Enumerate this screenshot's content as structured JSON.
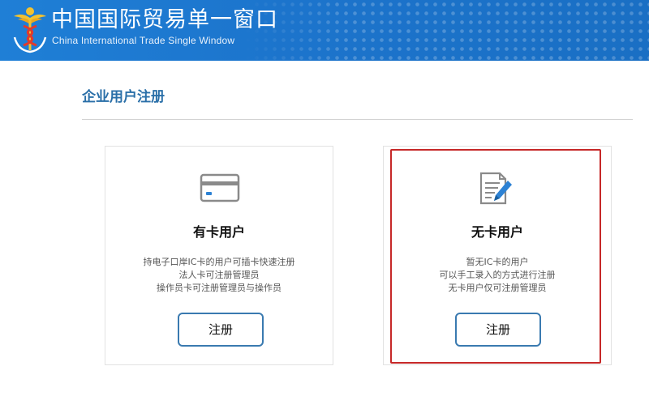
{
  "header": {
    "title_cn": "中国国际贸易单一窗口",
    "title_en": "China International Trade Single  Window",
    "logo_icon": "caduceus-logo-icon"
  },
  "page": {
    "title": "企业用户注册"
  },
  "cards": [
    {
      "icon": "card-icon",
      "title": "有卡用户",
      "desc": [
        "持电子口岸IC卡的用户可插卡快速注册",
        "法人卡可注册管理员",
        "操作员卡可注册管理员与操作员"
      ],
      "button_label": "注册"
    },
    {
      "icon": "document-edit-icon",
      "title": "无卡用户",
      "desc": [
        "暂无IC卡的用户",
        "可以手工录入的方式进行注册",
        "无卡用户仅可注册管理员"
      ],
      "button_label": "注册"
    }
  ],
  "colors": {
    "header_blue": "#1c74cc",
    "title_blue": "#2a6fa8",
    "button_border": "#3a7ab0",
    "highlight_red": "#c62828"
  }
}
